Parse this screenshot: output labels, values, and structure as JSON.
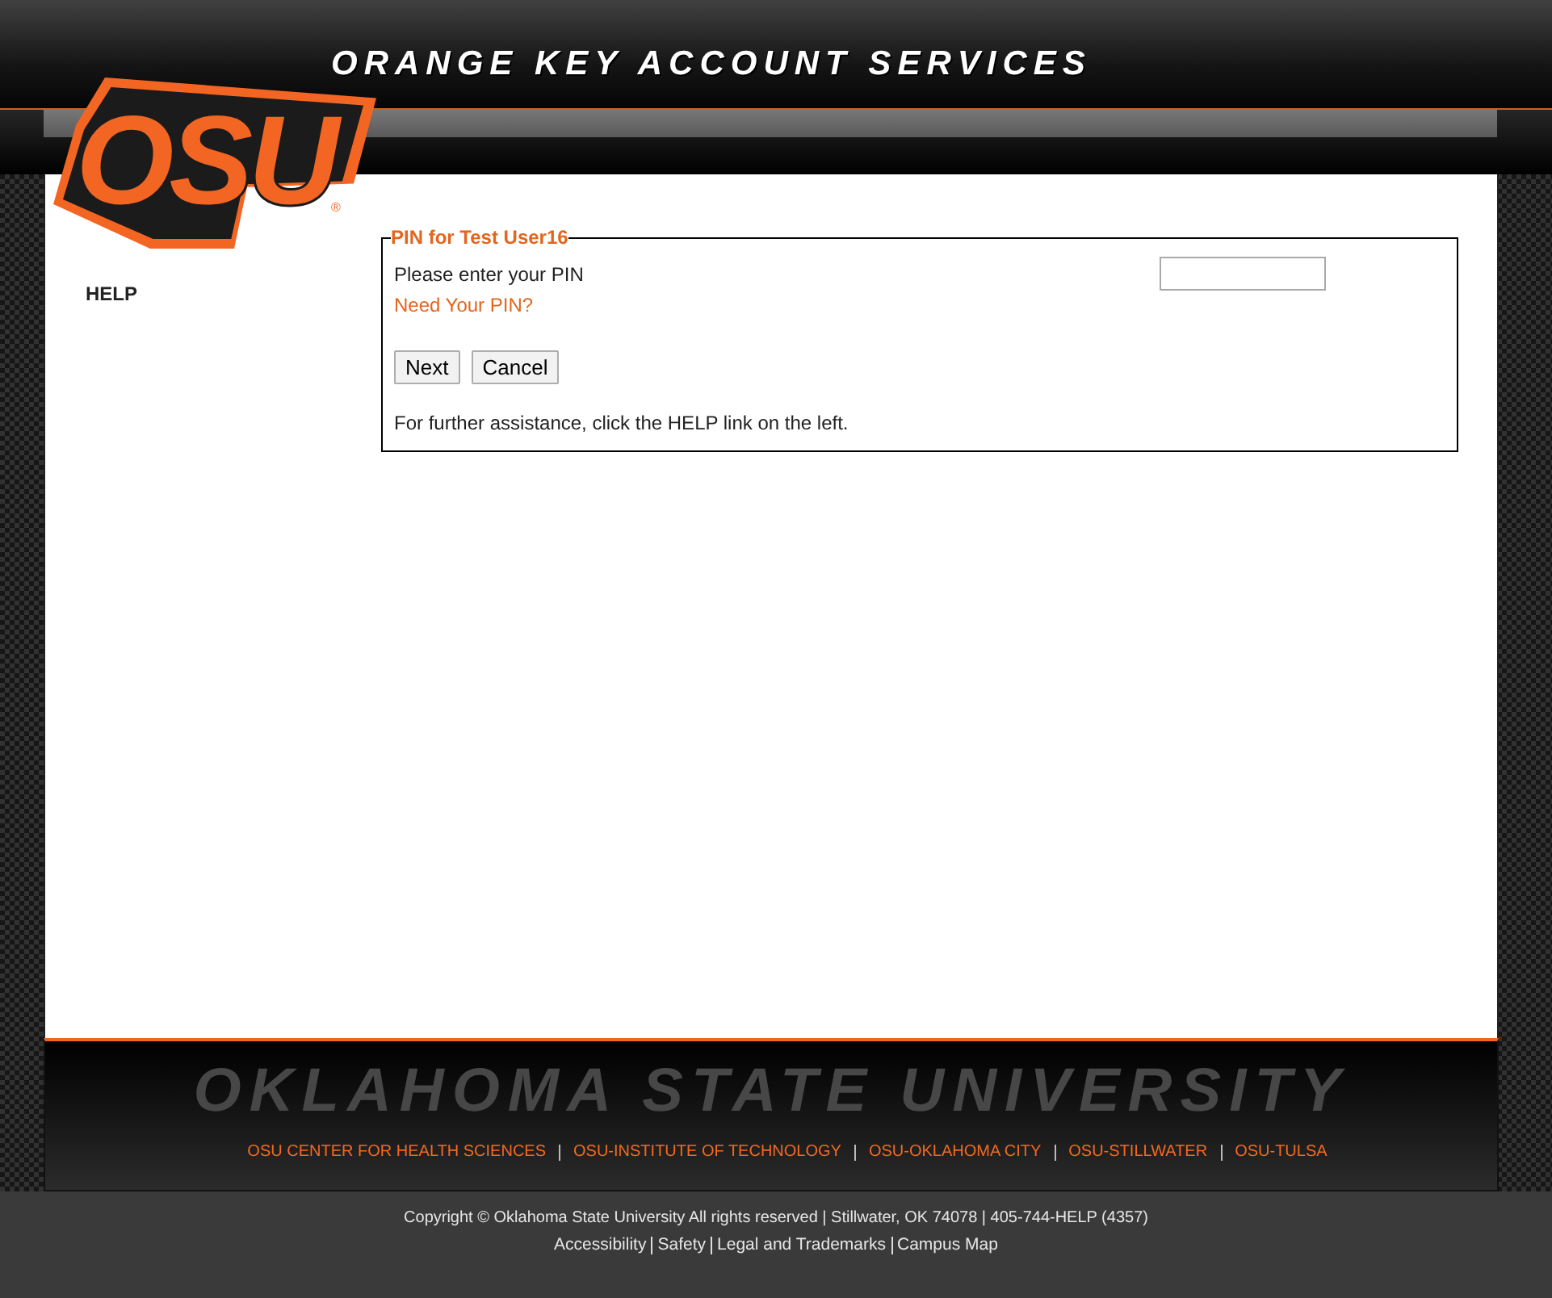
{
  "header": {
    "title": "ORANGE KEY ACCOUNT SERVICES",
    "logo": {
      "text": "OSU",
      "mark": "®"
    }
  },
  "sidebar": {
    "items": [
      {
        "label": "HELP"
      }
    ]
  },
  "form": {
    "legend": "PIN for Test User16",
    "pin_label": "Please enter your PIN",
    "help_link": "Need Your PIN?",
    "buttons": [
      "Next",
      "Cancel"
    ],
    "note": "For further assistance, click the HELP link on the left."
  },
  "footer": {
    "wordmark": "OKLAHOMA STATE UNIVERSITY",
    "campus_links": [
      "OSU CENTER FOR HEALTH SCIENCES",
      "OSU-INSTITUTE OF TECHNOLOGY",
      "OSU-OKLAHOMA CITY",
      "OSU-STILLWATER",
      "OSU-TULSA"
    ],
    "copyright": "Copyright © Oklahoma State University All rights reserved | Stillwater, OK 74078 | 405-744-HELP (4357)",
    "links": [
      "Accessibility",
      "Safety",
      "Legal and Trademarks",
      "Campus Map"
    ]
  }
}
